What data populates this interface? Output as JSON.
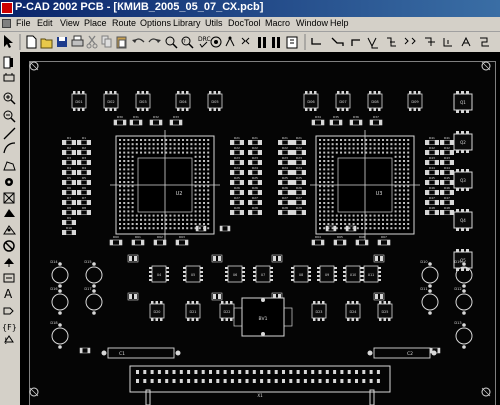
{
  "title": "P-CAD 2002 PCB - [КМИВ_2005_05_07_СХ.pcb]",
  "menu": {
    "items": [
      "File",
      "Edit",
      "View",
      "Place",
      "Route",
      "Options",
      "Library",
      "Utils",
      "DocTool",
      "Macro",
      "Window",
      "Help"
    ]
  },
  "toolbar": {
    "buttons": [
      "select",
      "new",
      "open",
      "save",
      "print",
      "cut",
      "copy",
      "paste",
      "undo",
      "redo",
      "zoom",
      "find",
      "drc",
      "route",
      "interactive-route",
      "mitre",
      "push",
      "via",
      "stack",
      "edit-layers",
      "route-mode-1",
      "route-mode-2",
      "route-mode-3",
      "route-mode-4",
      "route-mode-5"
    ]
  },
  "placetools": [
    "select",
    "place-component",
    "zoom-in",
    "zoom-out",
    "place-line",
    "place-arc",
    "place-polygon",
    "place-pad",
    "place-via",
    "place-copper",
    "place-cutout",
    "place-keepout",
    "place-point",
    "place-field",
    "place-text",
    "place-attribute",
    "place-dimension",
    "place-ref-point"
  ],
  "pcb": {
    "ics": [
      {
        "ref": "U2"
      },
      {
        "ref": "U3"
      }
    ],
    "top_chips": [
      "D01",
      "D02",
      "D03",
      "D04",
      "D05",
      "D06",
      "D07",
      "D08",
      "D09"
    ],
    "right_chips": [
      "Q1",
      "Q2",
      "Q3",
      "Q4",
      "Q5"
    ],
    "left_res_refs": [
      "R1",
      "R2",
      "R3",
      "R4",
      "R5",
      "R6",
      "R7",
      "R8",
      "R9",
      "R10"
    ],
    "center_res_refs": [
      "R21",
      "R22",
      "R23",
      "R24",
      "R25",
      "R26",
      "R27",
      "R28"
    ],
    "right_res_refs": [
      "R41",
      "R42",
      "R43",
      "R44",
      "R45",
      "R46",
      "R47",
      "R48"
    ],
    "mid_top_labels": [
      "R30",
      "R31",
      "R32",
      "R33",
      "R34",
      "R35",
      "R36",
      "R37"
    ],
    "mid_bottom_labels": [
      "R60",
      "R61",
      "R62",
      "R63",
      "R64",
      "R65",
      "R66",
      "R67"
    ],
    "leds": [
      "D14",
      "D15",
      "D16",
      "D17",
      "D18",
      "D19",
      "D10",
      "D11",
      "D12",
      "D13"
    ],
    "transistors": [
      "Q11",
      "Q12",
      "Q13",
      "Q14",
      "Q15",
      "Q16",
      "Q17",
      "Q18",
      "Q19",
      "Q20"
    ],
    "so_chips": [
      "U4",
      "U5",
      "U6",
      "U7",
      "U8",
      "U9",
      "U10",
      "U11"
    ],
    "bottom_chips": [
      "D20",
      "D21",
      "D22",
      "D23",
      "D24",
      "D25"
    ],
    "center_part": "BV1",
    "capacitor_left": "C1",
    "capacitor_right": "C2",
    "connector": "X1"
  }
}
